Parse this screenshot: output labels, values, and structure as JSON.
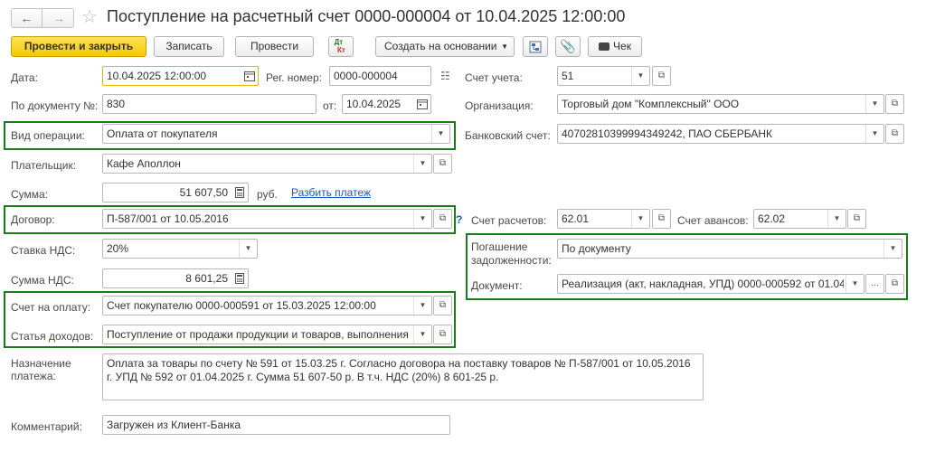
{
  "title": "Поступление на расчетный счет 0000-000004 от 10.04.2025 12:00:00",
  "toolbar": {
    "post_close": "Провести и закрыть",
    "save": "Записать",
    "post": "Провести",
    "dt_top": "Дт",
    "dt_bottom": "Кт",
    "create_based": "Создать на основании",
    "check": "Чек"
  },
  "fields": {
    "date_label": "Дата:",
    "date_value": "10.04.2025 12:00:00",
    "reg_label": "Рег. номер:",
    "reg_value": "0000-000004",
    "account_label": "Счет учета:",
    "account_value": "51",
    "doc_num_label": "По документу №:",
    "doc_num_value": "830",
    "from_label": "от:",
    "from_value": "10.04.2025",
    "org_label": "Организация:",
    "org_value": "Торговый дом \"Комплексный\" ООО",
    "op_label": "Вид операции:",
    "op_value": "Оплата от покупателя",
    "bank_label": "Банковский счет:",
    "bank_value": "40702810399994349242, ПАО СБЕРБАНК",
    "payer_label": "Плательщик:",
    "payer_value": "Кафе Аполлон",
    "sum_label": "Сумма:",
    "sum_value": "51 607,50",
    "currency": "руб.",
    "split_link": "Разбить платеж",
    "contract_label": "Договор:",
    "contract_value": "П-587/001 от 10.05.2016",
    "question": "?",
    "settle_acc_label": "Счет расчетов:",
    "settle_acc_value": "62.01",
    "adv_acc_label": "Счет авансов:",
    "adv_acc_value": "62.02",
    "vat_rate_label": "Ставка НДС:",
    "vat_rate_value": "20%",
    "debt_label_1": "Погашение",
    "debt_label_2": "задолженности:",
    "debt_value": "По документу",
    "vat_sum_label": "Сумма НДС:",
    "vat_sum_value": "8 601,25",
    "document_label": "Документ:",
    "document_value": "Реализация (акт, накладная, УПД) 0000-000592 от 01.04.",
    "invoice_label": "Счет на оплату:",
    "invoice_value": "Счет покупателю 0000-000591 от 15.03.2025 12:00:00",
    "income_label": "Статья доходов:",
    "income_value": "Поступление от продажи продукции и товаров, выполнения",
    "purpose_label_1": "Назначение",
    "purpose_label_2": "платежа:",
    "purpose_value": "Оплата за товары по счету № 591 от 15.03.25 г. Согласно договора на поставку товаров № П-587/001 от 10.05.2016 г. УПД № 592 от 01.04.2025 г. Сумма 51 607-50 р. В т.ч. НДС (20%) 8 601-25 р.",
    "comment_label": "Комментарий:",
    "comment_value": "Загружен из Клиент-Банка"
  },
  "colors": {
    "highlight_border": "#1b7a1b",
    "primary_button": "#f7c800",
    "link": "#1a56c4",
    "focus_border": "#f0b400"
  }
}
